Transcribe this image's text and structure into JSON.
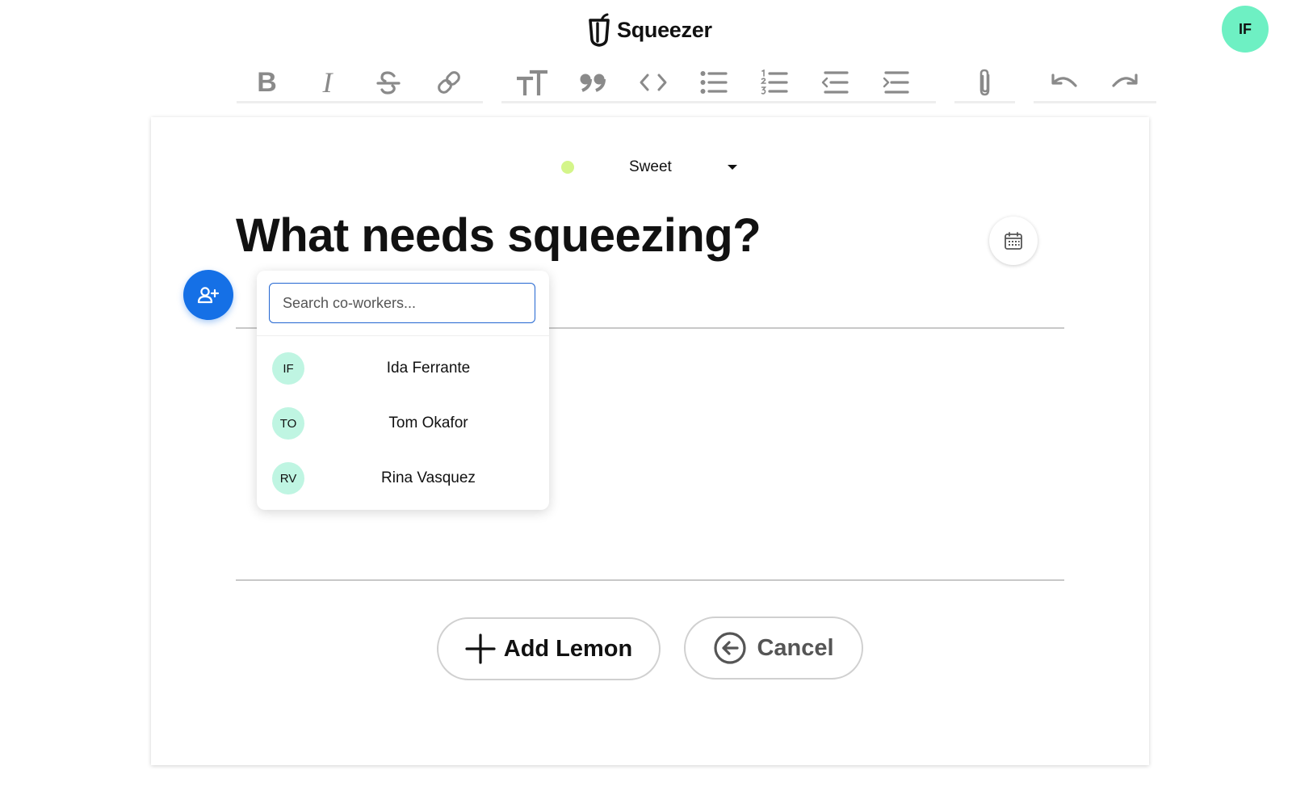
{
  "app": {
    "name": "Squeezer"
  },
  "user": {
    "initials": "IF"
  },
  "toolbar": {
    "bold_glyph": "B",
    "italic_glyph": "I",
    "icons": [
      "strikethrough-icon",
      "link-icon",
      "heading-icon",
      "quote-icon",
      "code-icon",
      "bullet-list-icon",
      "numbered-list-icon",
      "outdent-icon",
      "indent-icon",
      "attachment-icon",
      "undo-icon",
      "redo-icon"
    ]
  },
  "editor": {
    "mood": {
      "label": "Sweet",
      "color": "#d4f58a"
    },
    "heading": "What needs squeezing?"
  },
  "coworker_picker": {
    "search_placeholder": "Search co-workers...",
    "items": [
      {
        "initials": "IF",
        "name": "Ida Ferrante"
      },
      {
        "initials": "TO",
        "name": "Tom Okafor"
      },
      {
        "initials": "RV",
        "name": "Rina Vasquez"
      }
    ]
  },
  "actions": {
    "add_label": "Add Lemon",
    "cancel_label": "Cancel"
  },
  "colors": {
    "accent": "#1570e6",
    "avatar": "#6ef0c3",
    "avatar_light": "#bff5e2"
  }
}
